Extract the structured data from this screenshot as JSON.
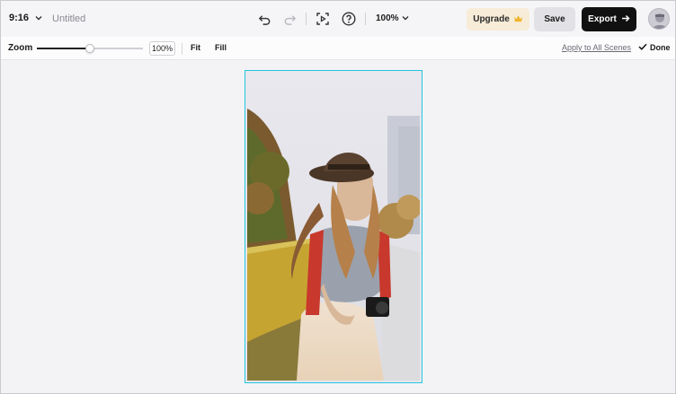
{
  "header": {
    "aspect_ratio": "9:16",
    "title": "Untitled",
    "zoom_level": "100%",
    "upgrade_label": "Upgrade",
    "save_label": "Save",
    "export_label": "Export"
  },
  "toolbar": {
    "zoom_label": "Zoom",
    "zoom_value": "100%",
    "zoom_slider_fraction": 0.5,
    "fit_label": "Fit",
    "fill_label": "Fill",
    "apply_all_label": "Apply to All Scenes",
    "done_label": "Done"
  },
  "colors": {
    "selection_border": "#22c7e0",
    "export_bg": "#111111",
    "upgrade_bg": "#f7ecd8",
    "crown": "#f0b429"
  },
  "icons": [
    "chevron-down-icon",
    "undo-icon",
    "redo-icon",
    "preview-play-icon",
    "help-icon",
    "crown-icon",
    "arrow-right-icon",
    "checkmark-icon",
    "avatar-icon"
  ]
}
